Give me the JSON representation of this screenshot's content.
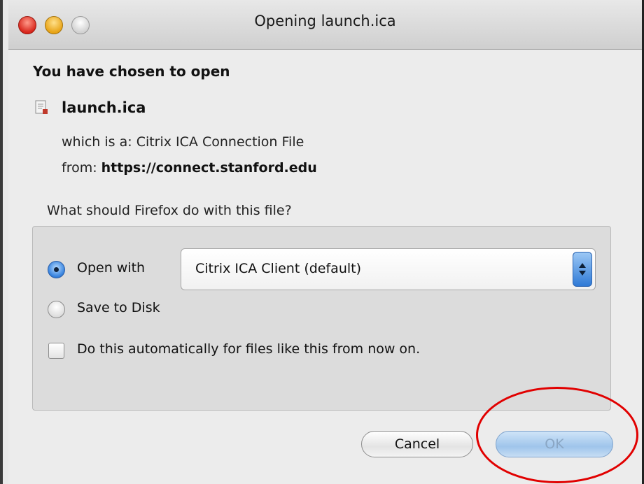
{
  "window": {
    "title": "Opening launch.ica"
  },
  "dialog": {
    "heading": "You have chosen to open",
    "filename": "launch.ica",
    "which_is": "which is a: Citrix ICA Connection File",
    "from_label": "from:",
    "from_url": "https://connect.stanford.edu",
    "question": "What should Firefox do with this file?"
  },
  "options": {
    "open_with_label": "Open with",
    "open_with_selected": true,
    "application": "Citrix ICA Client (default)",
    "save_to_disk_label": "Save to Disk",
    "save_to_disk_selected": false,
    "auto_label": "Do this automatically for files like this from now on.",
    "auto_checked": false
  },
  "buttons": {
    "cancel": "Cancel",
    "ok": "OK"
  },
  "colors": {
    "highlight": "#e10000",
    "accent": "#3b86e0"
  },
  "icons": {
    "close": "close-icon",
    "minimize": "minimize-icon",
    "zoom": "zoom-icon",
    "file": "file-icon",
    "select_arrows": "up-down-arrows-icon"
  }
}
